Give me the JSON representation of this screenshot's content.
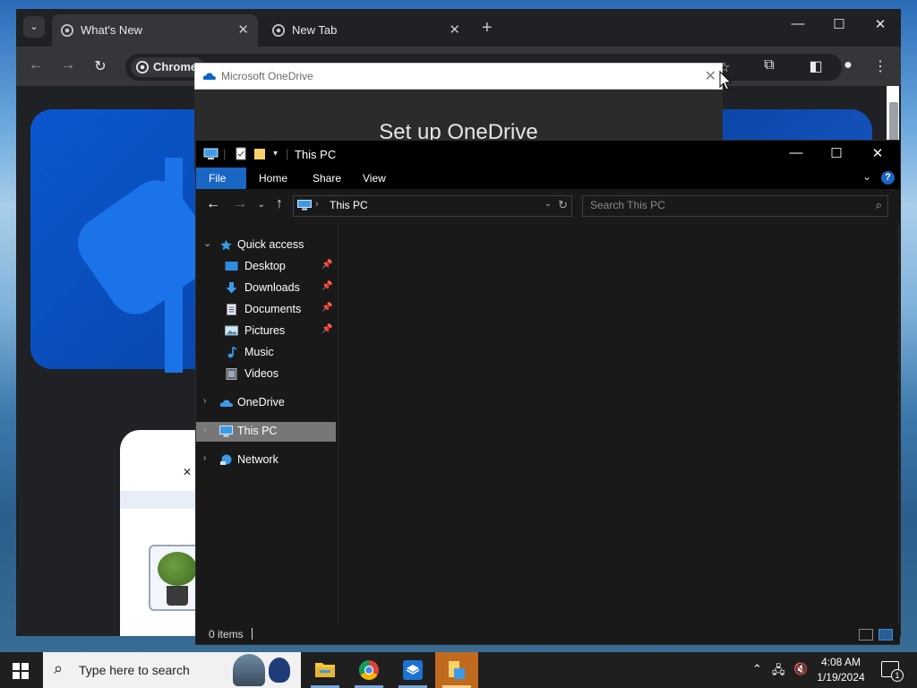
{
  "chrome": {
    "tabs": [
      {
        "label": "What's New",
        "active": true
      },
      {
        "label": "New Tab",
        "active": false
      }
    ],
    "omnibox_chip": "Chrome"
  },
  "onedrive": {
    "title": "Microsoft OneDrive",
    "heading": "Set up OneDrive"
  },
  "explorer": {
    "title": "This PC",
    "ribbon_tabs": [
      "File",
      "Home",
      "Share",
      "View"
    ],
    "address_crumb": "This PC",
    "search_placeholder": "Search This PC",
    "nav": {
      "quick_access": "Quick access",
      "quick_items": [
        "Desktop",
        "Downloads",
        "Documents",
        "Pictures",
        "Music",
        "Videos"
      ],
      "onedrive": "OneDrive",
      "this_pc": "This PC",
      "network": "Network"
    },
    "status_count": "0 items"
  },
  "taskbar": {
    "search_placeholder": "Type here to search",
    "time": "4:08 AM",
    "date": "1/19/2024",
    "notification_count": "1"
  },
  "colors": {
    "accent": "#1a66c4",
    "chrome_dark": "#202124",
    "explorer_bg": "#191919"
  }
}
